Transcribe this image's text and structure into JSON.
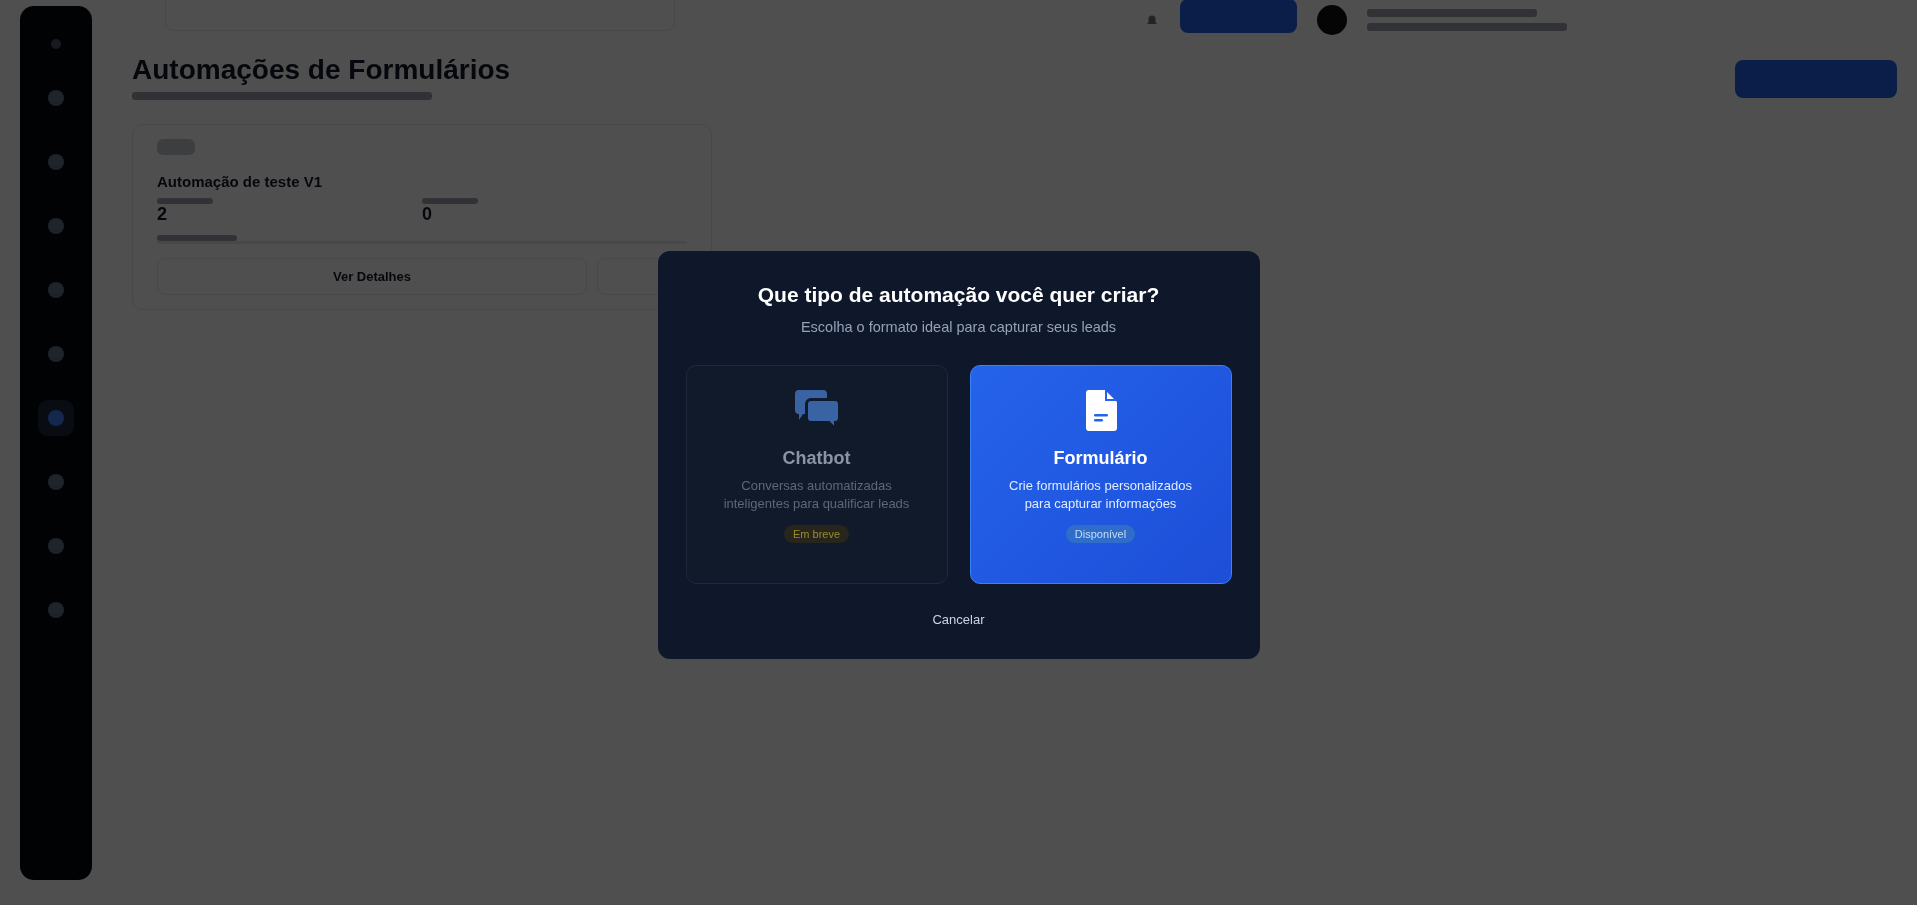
{
  "page": {
    "title": "Automações de Formulários"
  },
  "automation_card": {
    "title": "Automação de teste V1",
    "stats": [
      {
        "value": "2"
      },
      {
        "value": "0"
      }
    ],
    "buttons": [
      "Ver Detalhes"
    ]
  },
  "sidebar": {
    "items": [
      {
        "selected": false
      },
      {
        "selected": false
      },
      {
        "selected": false
      },
      {
        "selected": false
      },
      {
        "selected": false
      },
      {
        "selected": true
      },
      {
        "selected": false
      },
      {
        "selected": false
      },
      {
        "selected": false
      }
    ]
  },
  "modal": {
    "title": "Que tipo de automação você quer criar?",
    "subtitle": "Escolha o formato ideal para capturar seus leads",
    "options": [
      {
        "kind": "chat",
        "title": "Chatbot",
        "description": "Conversas automatizadas inteligentes para qualificar leads",
        "badge": "Em breve",
        "disabled": true
      },
      {
        "kind": "form",
        "title": "Formulário",
        "description": "Crie formulários personalizados para capturar informações",
        "badge": "Disponível",
        "disabled": false
      }
    ],
    "cancel": "Cancelar"
  }
}
